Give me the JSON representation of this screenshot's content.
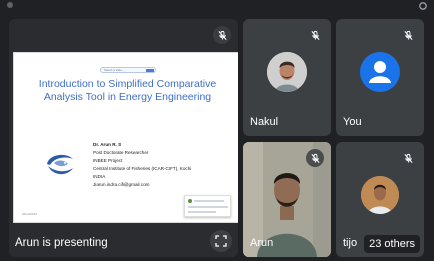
{
  "presenter": {
    "status": "Arun is presenting",
    "slide": {
      "url_text": "Select a slide...",
      "title_line1": "Introduction to Simplified Comparative",
      "title_line2": "Analysis Tool in Energy Engineering",
      "author_lines": [
        "Dr. Arun R. S",
        "Post Doctorate Researcher",
        "INBEE Project",
        "Central Institute of Fisheries (ICAR-CIFT), Kochi",
        "INDIA",
        "Jiarun.indra.cifi@gmail.com"
      ],
      "footnote": "04/12/2022",
      "accent_color": "#3f6fc2"
    }
  },
  "participants": [
    {
      "name": "Nakul",
      "avatar": "person-photo-avatar",
      "muted": true
    },
    {
      "name": "You",
      "avatar": "default-person-avatar",
      "avatar_color": "#1a73e8",
      "muted": true
    },
    {
      "name": "Arun",
      "avatar": "camera-video",
      "muted": true
    },
    {
      "name": "tijo",
      "avatar": "person-photo-avatar",
      "muted": true
    }
  ],
  "others": {
    "label": "23 others"
  },
  "theme": {
    "background": "#202124",
    "tile": "#3c4043",
    "text": "#ffffff"
  }
}
